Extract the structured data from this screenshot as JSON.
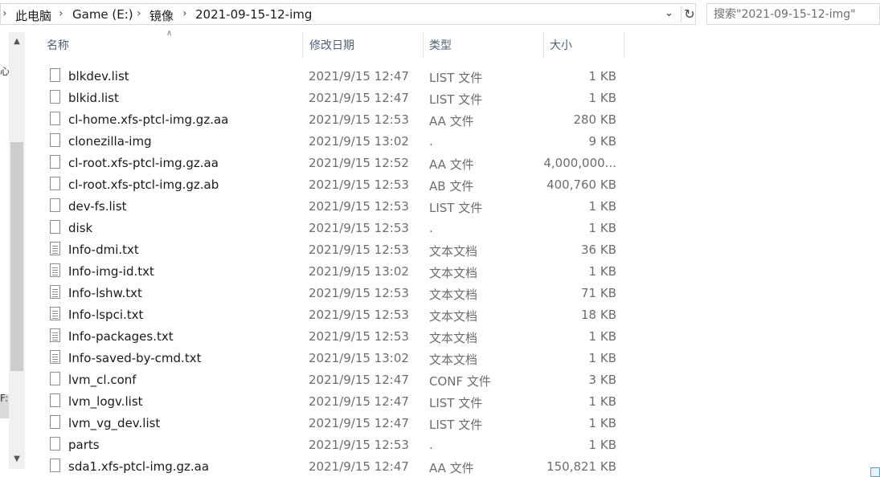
{
  "breadcrumb": {
    "items": [
      "此电脑",
      "Game (E:)",
      "镜像",
      "2021-09-15-12-img"
    ],
    "separator": "›"
  },
  "search": {
    "placeholder": "搜索\"2021-09-15-12-img\""
  },
  "icons": {
    "dropdown": "chevron-down-icon",
    "refresh": "refresh-icon",
    "scroll_up": "scroll-up-arrow-icon",
    "scroll_down": "scroll-down-arrow-icon",
    "sort": "sort-ascending-icon",
    "file": "file-icon",
    "text_file": "text-document-icon"
  },
  "left_pane": {
    "fragments": [
      "心",
      "F:)"
    ]
  },
  "columns": {
    "name": "名称",
    "date": "修改日期",
    "type": "类型",
    "size": "大小"
  },
  "files": [
    {
      "name": "blkdev.list",
      "date": "2021/9/15 12:47",
      "type": "LIST 文件",
      "size": "1 KB",
      "icon": "file"
    },
    {
      "name": "blkid.list",
      "date": "2021/9/15 12:47",
      "type": "LIST 文件",
      "size": "1 KB",
      "icon": "file"
    },
    {
      "name": "cl-home.xfs-ptcl-img.gz.aa",
      "date": "2021/9/15 12:53",
      "type": "AA 文件",
      "size": "280 KB",
      "icon": "file"
    },
    {
      "name": "clonezilla-img",
      "date": "2021/9/15 13:02",
      "type": ".",
      "size": "9 KB",
      "icon": "file"
    },
    {
      "name": "cl-root.xfs-ptcl-img.gz.aa",
      "date": "2021/9/15 12:52",
      "type": "AA 文件",
      "size": "4,000,000...",
      "icon": "file"
    },
    {
      "name": "cl-root.xfs-ptcl-img.gz.ab",
      "date": "2021/9/15 12:53",
      "type": "AB 文件",
      "size": "400,760 KB",
      "icon": "file"
    },
    {
      "name": "dev-fs.list",
      "date": "2021/9/15 12:53",
      "type": "LIST 文件",
      "size": "1 KB",
      "icon": "file"
    },
    {
      "name": "disk",
      "date": "2021/9/15 12:53",
      "type": ".",
      "size": "1 KB",
      "icon": "file"
    },
    {
      "name": "Info-dmi.txt",
      "date": "2021/9/15 12:53",
      "type": "文本文档",
      "size": "36 KB",
      "icon": "text"
    },
    {
      "name": "Info-img-id.txt",
      "date": "2021/9/15 13:02",
      "type": "文本文档",
      "size": "1 KB",
      "icon": "text"
    },
    {
      "name": "Info-lshw.txt",
      "date": "2021/9/15 12:53",
      "type": "文本文档",
      "size": "71 KB",
      "icon": "text"
    },
    {
      "name": "Info-lspci.txt",
      "date": "2021/9/15 12:53",
      "type": "文本文档",
      "size": "18 KB",
      "icon": "text"
    },
    {
      "name": "Info-packages.txt",
      "date": "2021/9/15 12:53",
      "type": "文本文档",
      "size": "1 KB",
      "icon": "text"
    },
    {
      "name": "Info-saved-by-cmd.txt",
      "date": "2021/9/15 13:02",
      "type": "文本文档",
      "size": "1 KB",
      "icon": "text"
    },
    {
      "name": "lvm_cl.conf",
      "date": "2021/9/15 12:47",
      "type": "CONF 文件",
      "size": "3 KB",
      "icon": "file"
    },
    {
      "name": "lvm_logv.list",
      "date": "2021/9/15 12:47",
      "type": "LIST 文件",
      "size": "1 KB",
      "icon": "file"
    },
    {
      "name": "lvm_vg_dev.list",
      "date": "2021/9/15 12:47",
      "type": "LIST 文件",
      "size": "1 KB",
      "icon": "file"
    },
    {
      "name": "parts",
      "date": "2021/9/15 12:53",
      "type": ".",
      "size": "1 KB",
      "icon": "file"
    },
    {
      "name": "sda1.xfs-ptcl-img.gz.aa",
      "date": "2021/9/15 12:47",
      "type": "AA 文件",
      "size": "150,821 KB",
      "icon": "file"
    }
  ]
}
